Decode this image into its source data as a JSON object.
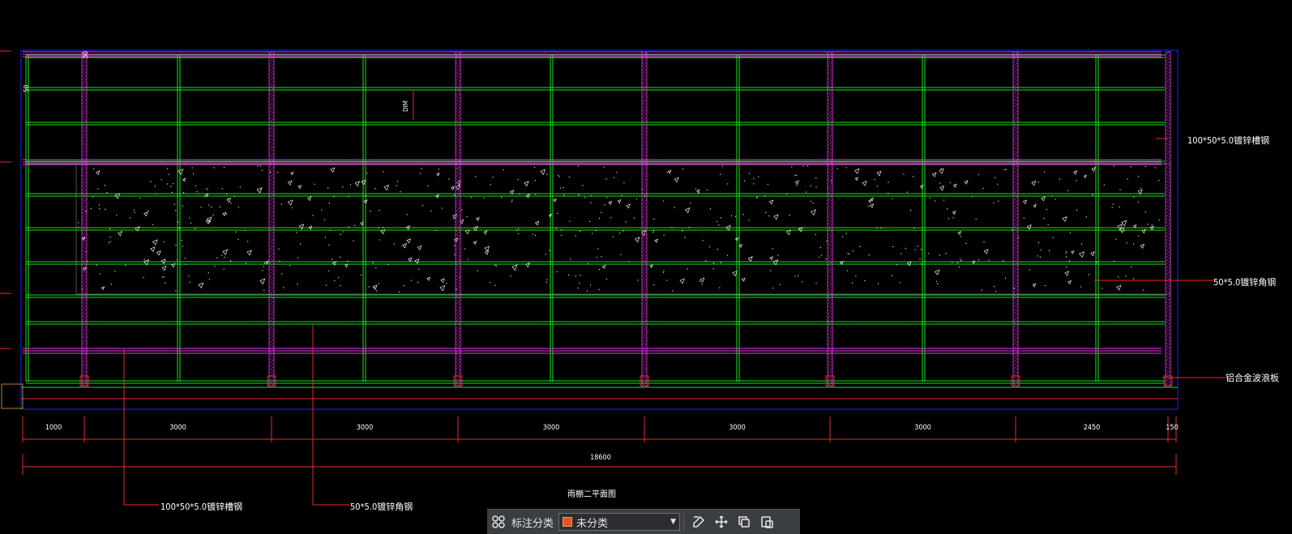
{
  "drawing": {
    "colors": {
      "grid": "#19e619",
      "beam": "#e63be6",
      "dim": "#e62b2b",
      "frame": "#1a1ae6",
      "text": "#ffffff"
    },
    "labels": {
      "right_top": "100*50*5.0镀锌槽钢",
      "right_mid": "50*5.0镀锌角钢",
      "right_bottom": "铝合金波浪板",
      "bottom_left": "100*50*5.0镀锌槽钢",
      "bottom_center": "50*5.0镀锌角钢",
      "title": "雨棚二平面图",
      "vertical_dim_a": "50",
      "vertical_dim_b": "50",
      "center_tag": "DIM"
    },
    "dimensions": [
      "1000",
      "3000",
      "3000",
      "3000",
      "3000",
      "3000",
      "2450",
      "150"
    ],
    "total_dimension": "18600"
  },
  "toolbar": {
    "label": "标注分类",
    "select_value": "未分类",
    "icons": [
      "grid-icon",
      "edit-icon",
      "move-icon",
      "copy-icon",
      "paste-icon"
    ]
  }
}
